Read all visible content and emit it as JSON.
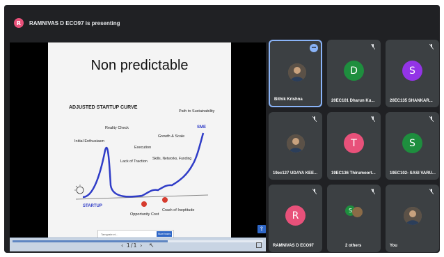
{
  "presenting": {
    "initial": "R",
    "text": "RAMNIVAS D ECO97 is presenting",
    "color": "#e8517a"
  },
  "slide": {
    "title": "Non predictable",
    "curve_title": "ADJUSTED STARTUP CURVE",
    "labels": {
      "initial": "Initial Enthusiasm",
      "reality": "Reality Check",
      "lack": "Lack of Traction",
      "execution": "Execution",
      "growth": "Growth & Scale",
      "skills": "Skills, Networks, Funding",
      "path": "Path to Sustainability",
      "sme": "SME",
      "startup": "STARTUP",
      "opportunity": "Opportunity Cost",
      "crash": "Crash of Ineptitude"
    },
    "translate_bar": {
      "placeholder": "Tamgrate et...",
      "button": "Start trans"
    }
  },
  "footer": {
    "controls": "‹ 1/1 ›"
  },
  "participants": [
    {
      "name": "Bithik Krishna",
      "type": "photo",
      "active": true
    },
    {
      "name": "20EC101 Dharun Ku...",
      "type": "letter",
      "letter": "D",
      "color": "#1e8e3e"
    },
    {
      "name": "20EC135 SHANKAR...",
      "type": "letter",
      "letter": "S",
      "color": "#9334e6"
    },
    {
      "name": "19ec127 UDAYA KEE...",
      "type": "photo"
    },
    {
      "name": "19EC136 Thirumoort...",
      "type": "letter",
      "letter": "T",
      "color": "#e8517a"
    },
    {
      "name": "19EC102- SASI VARU...",
      "type": "letter",
      "letter": "S",
      "color": "#1e8e3e"
    },
    {
      "name": "RAMNIVAS D ECO97",
      "type": "letter",
      "letter": "R",
      "color": "#e8517a"
    },
    {
      "name": "2 others",
      "type": "group",
      "letter": "S"
    },
    {
      "name": "You",
      "type": "photo"
    }
  ]
}
